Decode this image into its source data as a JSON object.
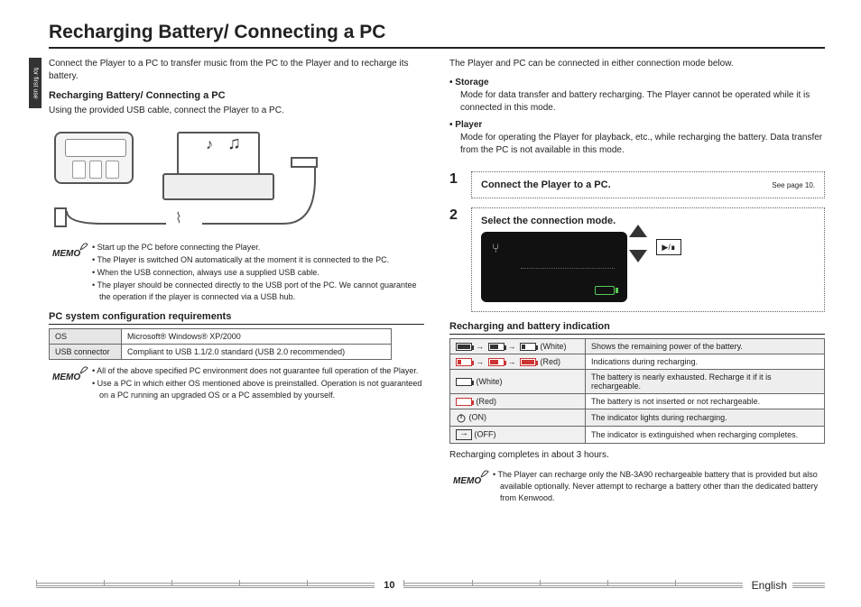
{
  "side_tab": "for first use",
  "title": "Recharging Battery/ Connecting a PC",
  "left": {
    "intro": "Connect the Player to a PC to transfer music from the PC to the Player and to recharge its battery.",
    "sub1": "Recharging Battery/ Connecting a PC",
    "sub1_text": "Using the provided USB cable, connect the Player to a PC.",
    "memo1": [
      "Start up the PC before connecting the Player.",
      "The Player is switched ON automatically at the moment it is connected to the PC.",
      "When the USB connection, always use a supplied USB cable.",
      "The player should be connected directly to the USB port of the PC. We cannot guarantee the operation if the player is connected via a USB hub."
    ],
    "sub2": "PC system configuration requirements",
    "req": {
      "os_label": "OS",
      "os_value": "Microsoft® Windows® XP/2000",
      "usb_label": "USB connector",
      "usb_value": "Compliant to USB 1.1/2.0 standard (USB 2.0 recommended)"
    },
    "memo2": [
      "All of the above specified PC environment does not guarantee full operation of the Player.",
      "Use a PC in which either OS mentioned above is preinstalled. Operation is not guaranteed on a PC running an upgraded OS or a PC assembled by yourself."
    ]
  },
  "right": {
    "intro": "The Player and PC can be connected in either connection mode below.",
    "modes": [
      {
        "name": "Storage",
        "desc": "Mode for data transfer and battery recharging. The Player cannot be operated while it is connected in this mode."
      },
      {
        "name": "Player",
        "desc": "Mode for operating the Player for playback, etc., while recharging the battery. Data transfer from the PC is not available in this mode."
      }
    ],
    "step1": {
      "num": "1",
      "title": "Connect the Player to a PC.",
      "ref": "See page 10."
    },
    "step2": {
      "num": "2",
      "title": "Select the connection mode."
    },
    "sub3": "Recharging and battery indication",
    "batt_rows": [
      {
        "label_suffix": "(White)",
        "desc": "Shows the remaining power of the battery."
      },
      {
        "label_suffix": "(Red)",
        "desc": "Indications during recharging."
      },
      {
        "label_suffix": "(White)",
        "desc": "The battery is nearly exhausted. Recharge it if it is rechargeable."
      },
      {
        "label_suffix": "(Red)",
        "desc": "The battery is not inserted or not rechargeable."
      },
      {
        "label_suffix": "(ON)",
        "desc": "The indicator lights during recharging."
      },
      {
        "label_suffix": "(OFF)",
        "desc": "The indicator is extinguished when recharging completes."
      }
    ],
    "recharge_note": "Recharging completes in about 3 hours.",
    "memo3": [
      "The Player can recharge only the NB-3A90 rechargeable battery that is provided but also available optionally. Never attempt to recharge a battery other than the dedicated battery from Kenwood."
    ]
  },
  "memo_label": "MEMO",
  "footer": {
    "page": "10",
    "lang": "English"
  }
}
